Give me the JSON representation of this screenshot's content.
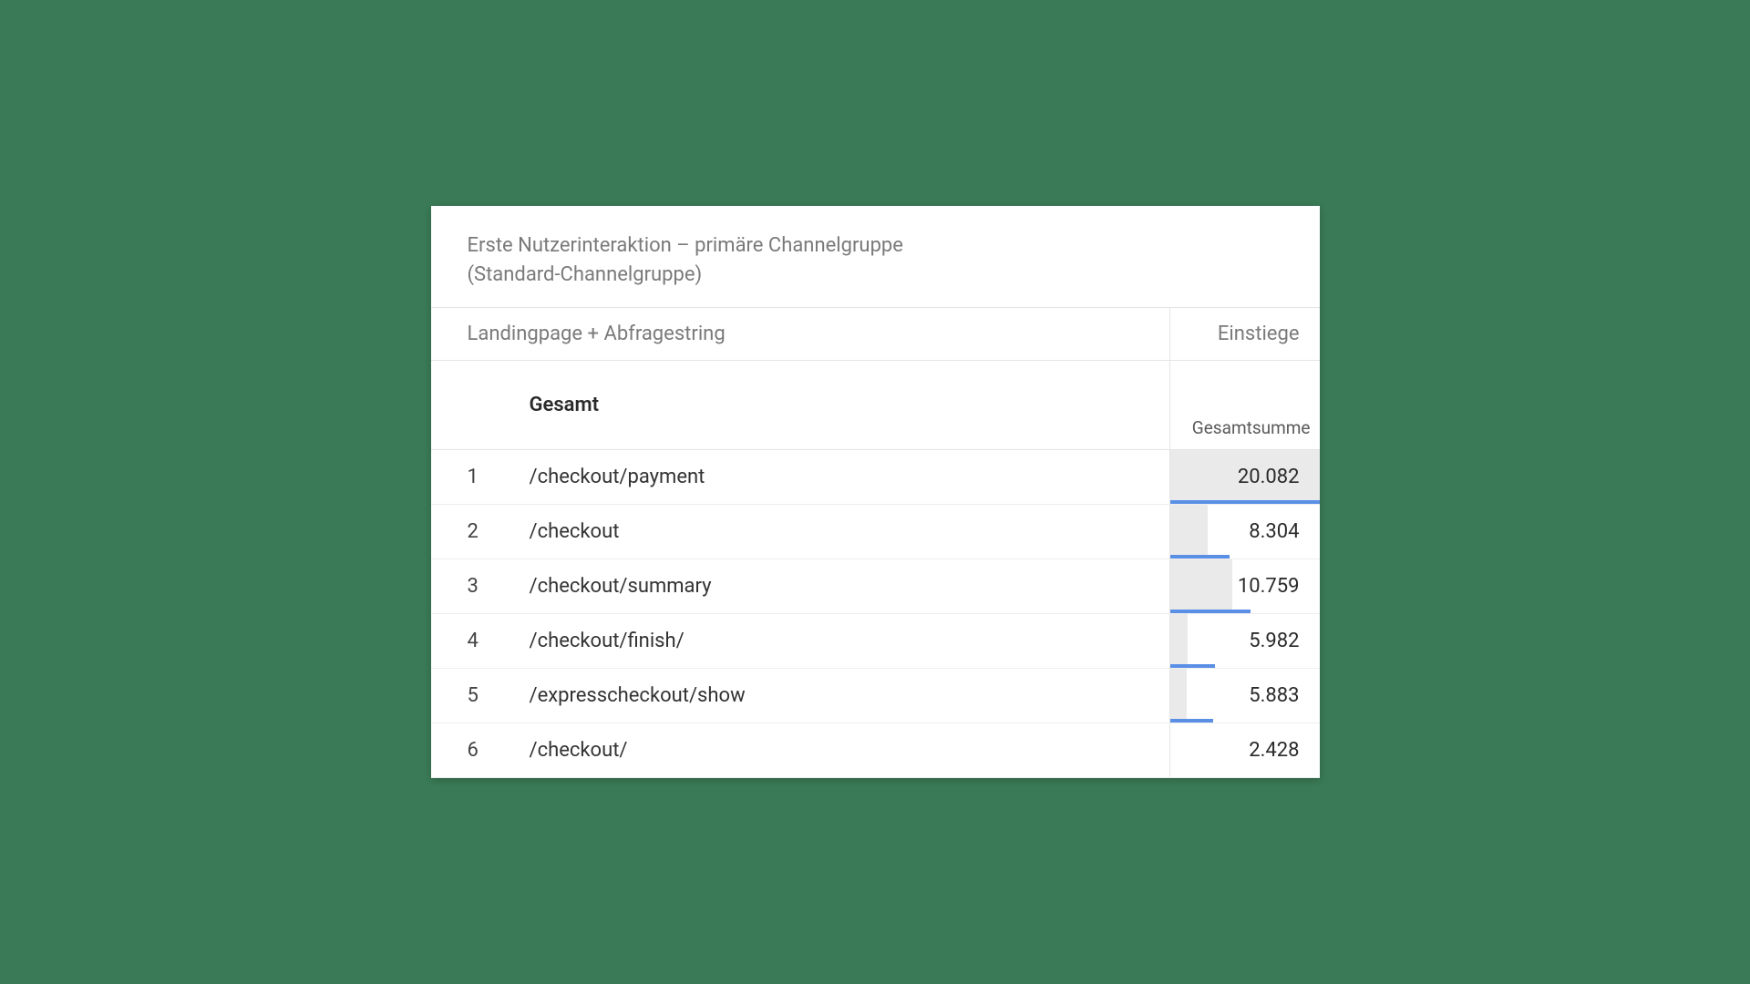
{
  "header": {
    "title_line1": "Erste Nutzerinteraktion – primäre Channelgruppe",
    "title_line2": "(Standard-Channelgruppe)",
    "dimension_label": "Landingpage + Abfragestring",
    "metric_label": "Einstiege"
  },
  "total": {
    "label": "Gesamt",
    "sum_label": "Gesamtsumme"
  },
  "rows": [
    {
      "n": "1",
      "path": "/checkout/payment",
      "value": "20.082",
      "bar_bg_pct": 100,
      "bar_fg_pct": 100
    },
    {
      "n": "2",
      "path": "/checkout",
      "value": "8.304",
      "bar_bg_pct": 25,
      "bar_fg_pct": 40
    },
    {
      "n": "3",
      "path": "/checkout/summary",
      "value": "10.759",
      "bar_bg_pct": 42,
      "bar_fg_pct": 54
    },
    {
      "n": "4",
      "path": "/checkout/finish/",
      "value": "5.982",
      "bar_bg_pct": 12,
      "bar_fg_pct": 30
    },
    {
      "n": "5",
      "path": "/expresscheckout/show",
      "value": "5.883",
      "bar_bg_pct": 11,
      "bar_fg_pct": 29
    },
    {
      "n": "6",
      "path": "/checkout/",
      "value": "2.428",
      "bar_bg_pct": 0,
      "bar_fg_pct": 0
    }
  ]
}
